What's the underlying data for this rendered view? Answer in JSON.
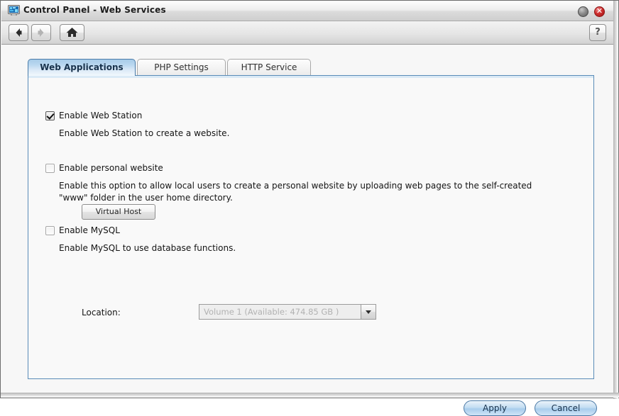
{
  "window": {
    "title": "Control Panel - Web Services",
    "icon": "control-panel-icon",
    "minimize_label": "",
    "close_label": "✕"
  },
  "toolbar": {
    "back_icon": "arrow-left-icon",
    "forward_icon": "arrow-right-icon",
    "home_icon": "home-icon",
    "help_label": "?"
  },
  "tabs": [
    {
      "id": "web-applications",
      "label": "Web Applications",
      "active": true
    },
    {
      "id": "php-settings",
      "label": "PHP Settings",
      "active": false
    },
    {
      "id": "http-service",
      "label": "HTTP Service",
      "active": false
    }
  ],
  "form": {
    "web_station": {
      "checkbox_label": "Enable Web Station",
      "checked": true,
      "description": "Enable Web Station to create a website.",
      "button_label": "Virtual Host"
    },
    "personal_website": {
      "checkbox_label": "Enable personal website",
      "checked": false,
      "description": "Enable this option to allow local users to create a personal website by uploading web pages to the self-created \"www\" folder in the user home directory."
    },
    "mysql": {
      "checkbox_label": "Enable MySQL",
      "checked": false,
      "description": "Enable MySQL to use database functions.",
      "location_label": "Location:",
      "location_value": "Volume 1 (Available: 474.85 GB )",
      "location_disabled": true
    }
  },
  "footer": {
    "apply_label": "Apply",
    "cancel_label": "Cancel"
  },
  "colors": {
    "accent_blue": "#5a8cb8",
    "tab_active_blue": "#a7cbe8",
    "close_red": "#cf3030",
    "disabled_text": "#b2b2b2"
  }
}
